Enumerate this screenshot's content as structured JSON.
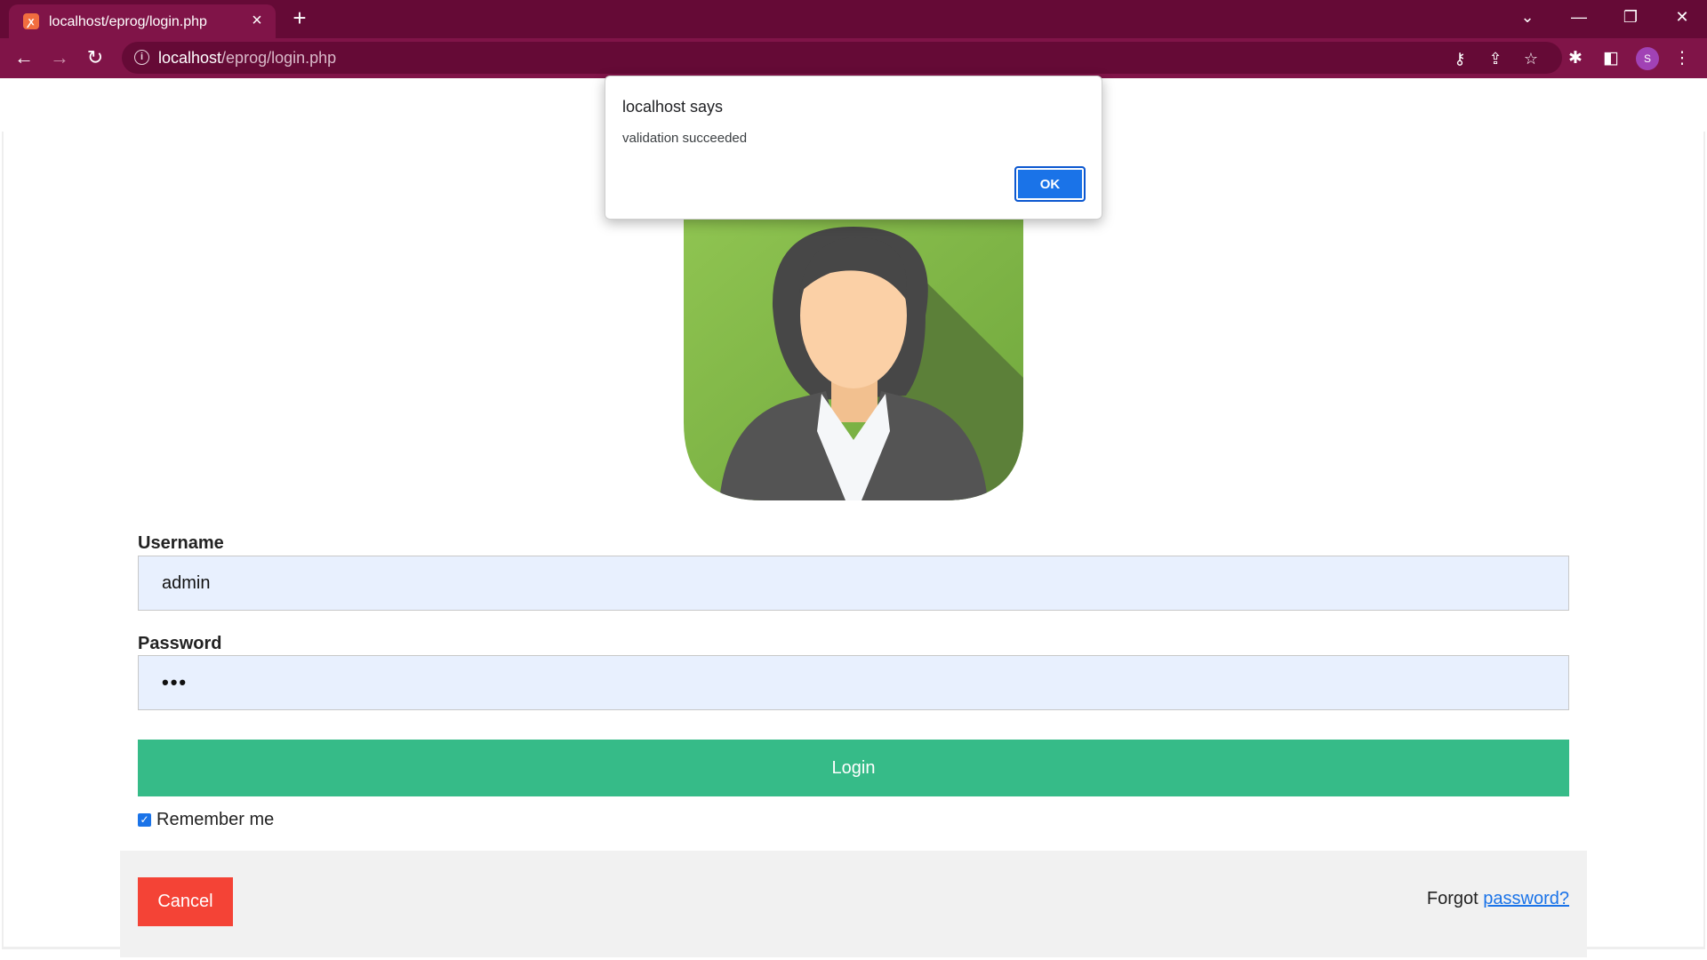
{
  "browser": {
    "tab_title": "localhost/eprog/login.php",
    "tab_favicon": "xampp-icon",
    "url_host": "localhost",
    "url_path": "/eprog/login.php",
    "profile_initial": "S",
    "theme_color": "#801448"
  },
  "dialog": {
    "title": "localhost says",
    "message": "validation succeeded",
    "ok_label": "OK"
  },
  "form": {
    "username_label": "Username",
    "username_value": "admin",
    "password_label": "Password",
    "password_value": "•••",
    "login_label": "Login",
    "remember_label": "Remember me",
    "remember_checked": true,
    "cancel_label": "Cancel",
    "forgot_text": "Forgot",
    "forgot_link": "password?"
  },
  "colors": {
    "login": "#36bb88",
    "cancel": "#f44336",
    "link": "#1a73e8",
    "input_bg": "#e8f0fe"
  }
}
